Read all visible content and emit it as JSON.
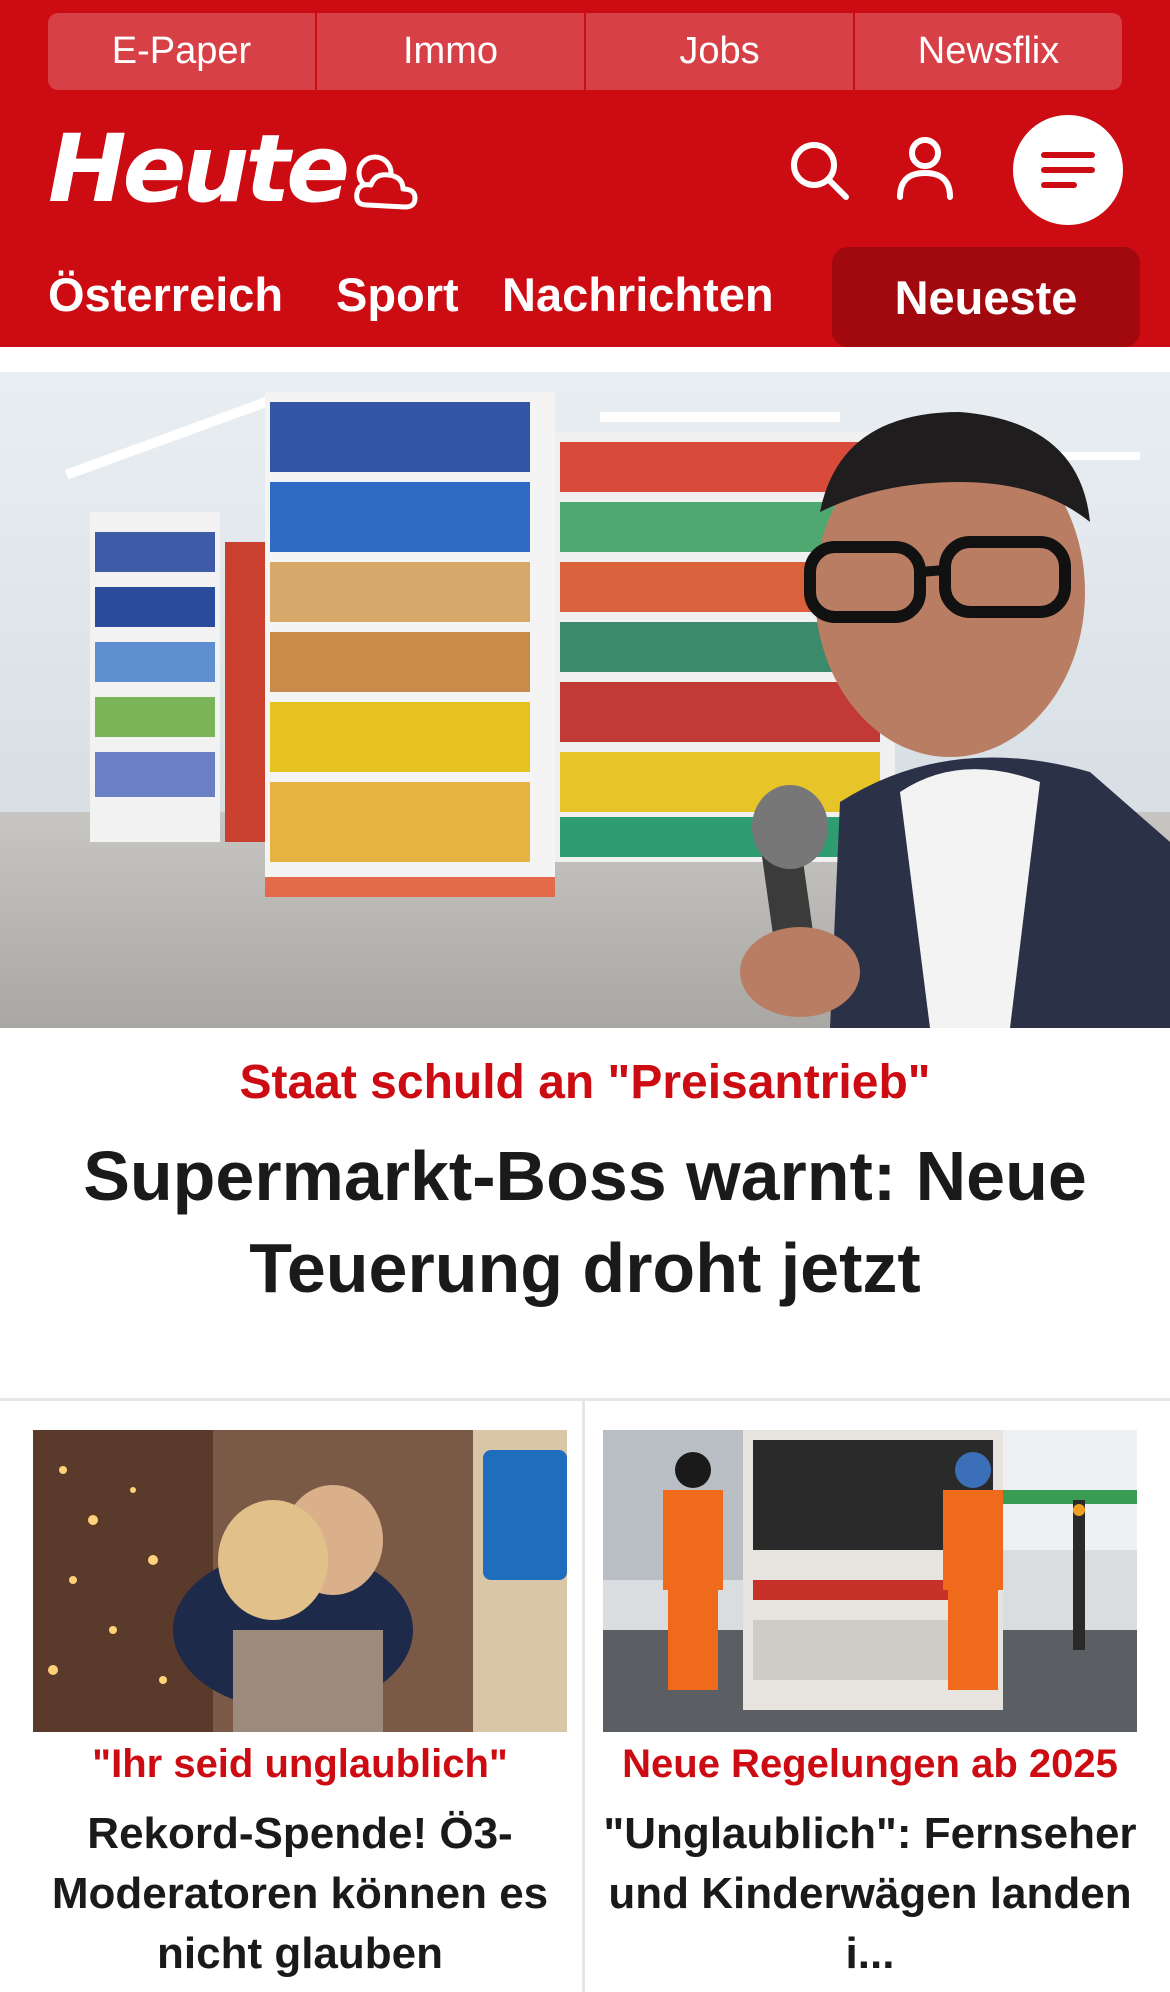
{
  "top_links": [
    "E-Paper",
    "Immo",
    "Jobs",
    "Newsflix"
  ],
  "brand": {
    "logo": "Heute"
  },
  "nav": {
    "items": [
      "Österreich",
      "Sport",
      "Nachrichten"
    ],
    "active": "Neueste"
  },
  "colors": {
    "brand_red": "#cc0b12",
    "active_tab": "#a2090e",
    "text": "#1a1a1a"
  },
  "icons": [
    "weather-icon",
    "search-icon",
    "user-icon",
    "menu-icon"
  ],
  "hero": {
    "kicker": "Staat schuld an \"Preisantrieb\"",
    "title": "Supermarkt-Boss warnt: Neue Teuerung droht jetzt"
  },
  "cards": [
    {
      "kicker": "\"Ihr seid unglaublich\"",
      "title": "Rekord-Spende! Ö3-Moderatoren können es nicht glauben"
    },
    {
      "kicker": "Neue Regelungen ab 2025",
      "title": "\"Unglaublich\": Fernseher und Kinderwägen landen i..."
    }
  ]
}
